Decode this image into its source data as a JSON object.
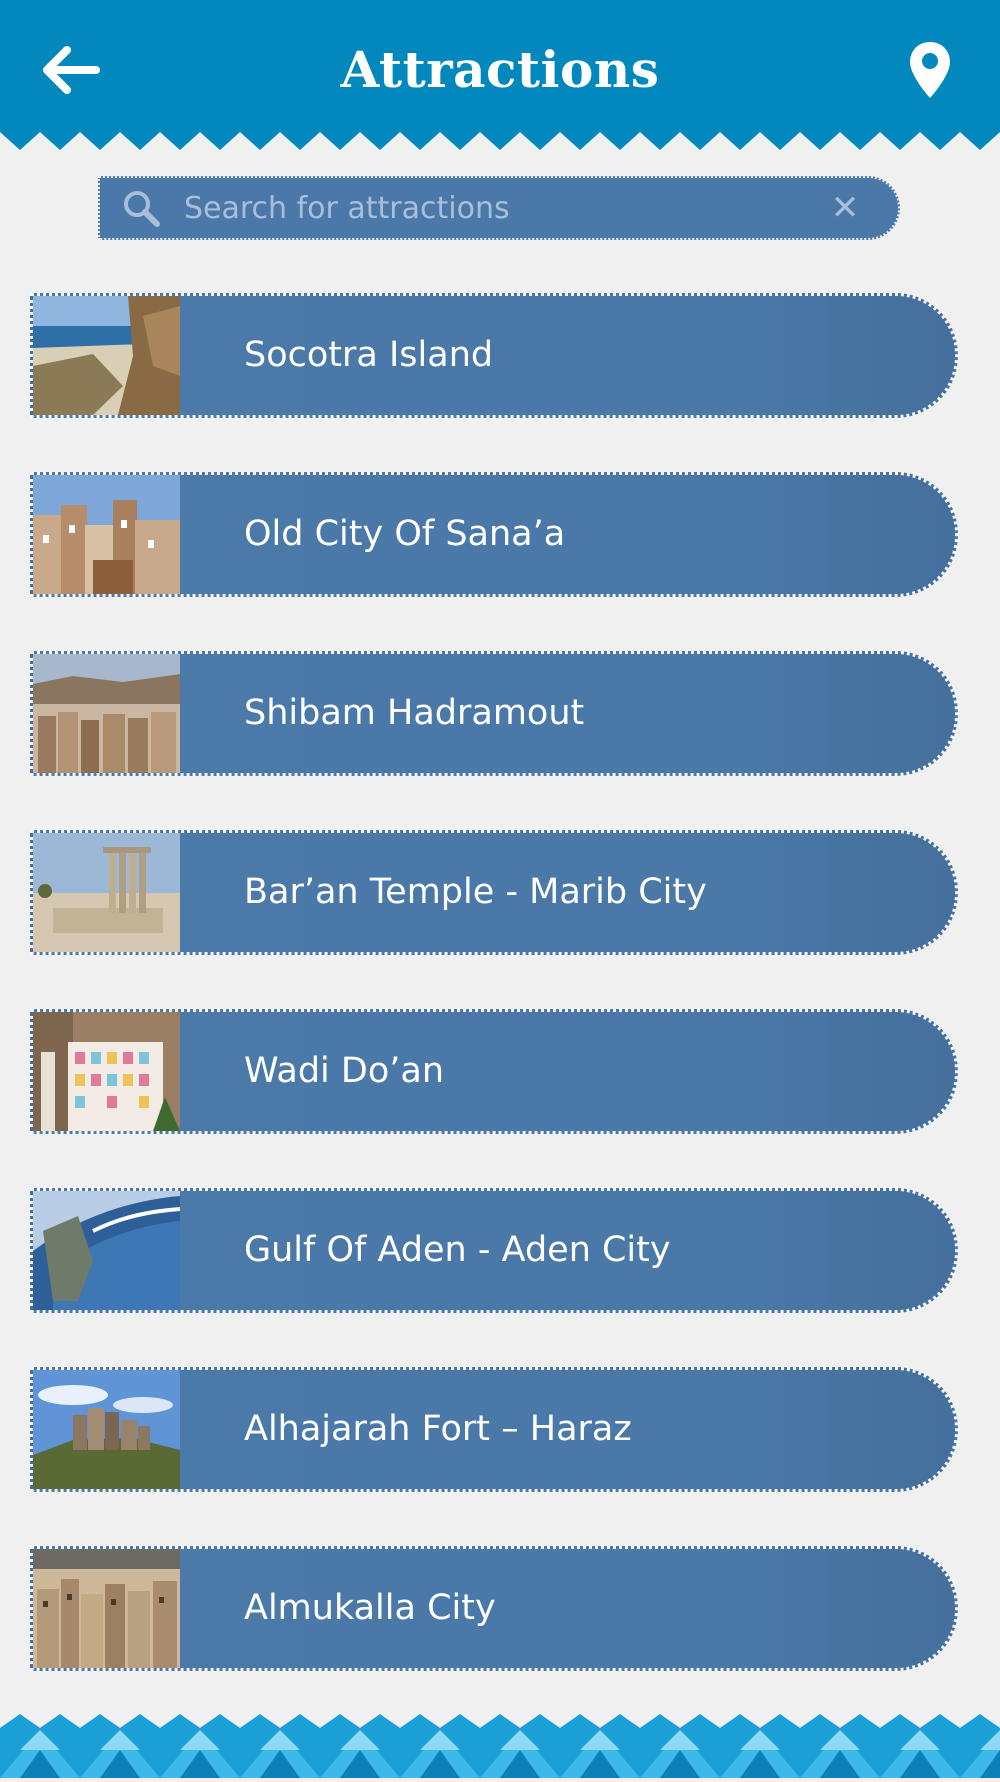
{
  "header": {
    "title": "Attractions",
    "back_icon": "arrow-left-icon",
    "location_icon": "map-pin-icon"
  },
  "search": {
    "placeholder": "Search for attractions",
    "value": "",
    "icon": "magnifier-icon",
    "clear_label": "✕"
  },
  "attractions": [
    {
      "name": "Socotra Island",
      "thumb": "coastal-cliff-photo"
    },
    {
      "name": "Old City Of Sana’a",
      "thumb": "old-city-towers-photo"
    },
    {
      "name": "Shibam Hadramout",
      "thumb": "mudbrick-city-photo"
    },
    {
      "name": "Bar’an Temple - Marib City",
      "thumb": "temple-pillars-photo"
    },
    {
      "name": "Wadi Do’an",
      "thumb": "painted-building-photo"
    },
    {
      "name": "Gulf Of Aden - Aden City",
      "thumb": "ocean-wave-photo"
    },
    {
      "name": "Alhajarah Fort – Haraz",
      "thumb": "hilltop-fort-photo"
    },
    {
      "name": "Almukalla City",
      "thumb": "city-skyline-photo"
    }
  ],
  "colors": {
    "header": "#0288bd",
    "item_bg": "#4a78a8",
    "page_bg": "#f0f0f1"
  }
}
